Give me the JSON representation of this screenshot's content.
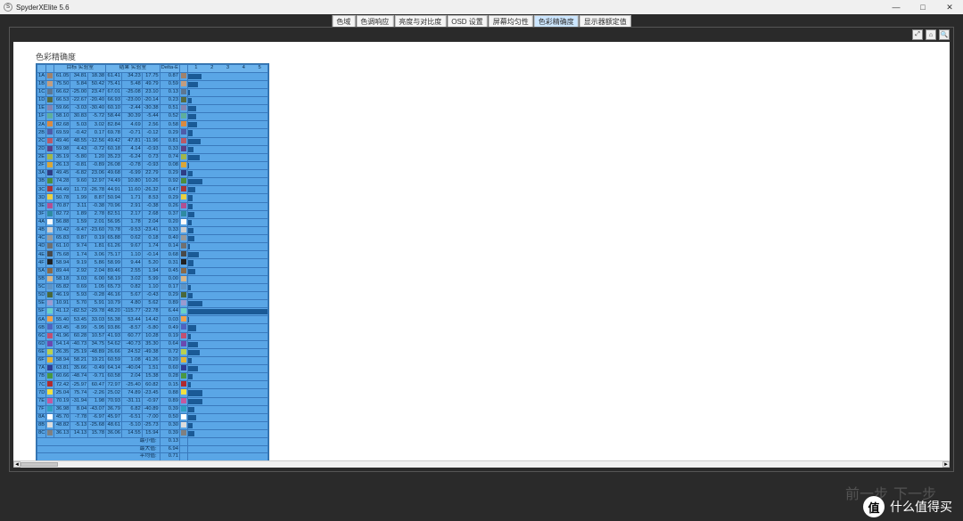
{
  "app": {
    "icon": "S",
    "title": "SpyderXElite 5.6"
  },
  "winbtn": {
    "min": "—",
    "max": "□",
    "close": "✕"
  },
  "tabs": [
    "色域",
    "色调响应",
    "亮度与对比度",
    "OSD 设置",
    "屏幕均匀性",
    "色彩精确度",
    "显示器额定值"
  ],
  "active_tab": 5,
  "toolbar": {
    "i1": "⤢",
    "i2": "⌂",
    "i3": "🔍"
  },
  "scroll": {
    "left": "◄",
    "right": "►"
  },
  "report": {
    "title": "色彩精确度"
  },
  "header": {
    "idx": "",
    "swatch": "",
    "target": "目标 实验室",
    "result": "结果 实验室",
    "delta": "Delta-E",
    "axis": [
      "1",
      "2",
      "3",
      "4",
      "5"
    ]
  },
  "summary": {
    "min_label": "最小值:",
    "min": "0.13",
    "max_label": "最大值:",
    "max": "6.94",
    "avg_label": "平均值:",
    "avg": "0.71"
  },
  "footer": {
    "prev": "前一步",
    "next": "下一步"
  },
  "watermark": {
    "logo": "值",
    "text": "什么值得买"
  },
  "chart_data": {
    "type": "table+bar",
    "bar_axis_max": 5,
    "columns": [
      "idx",
      "color",
      "target_L",
      "target_a",
      "target_b",
      "result_L",
      "result_a",
      "result_b",
      "delta_e"
    ],
    "rows": [
      {
        "idx": "1A",
        "color": "#a0826b",
        "t": [
          61.05,
          34.81,
          18.38
        ],
        "r": [
          61.41,
          34.23,
          17.75
        ],
        "d": 0.87
      },
      {
        "idx": "1B",
        "color": "#c29d80",
        "t": [
          75.5,
          5.84,
          50.42
        ],
        "r": [
          75.41,
          5.48,
          49.79
        ],
        "d": 0.59
      },
      {
        "idx": "1C",
        "color": "#5e7792",
        "t": [
          66.62,
          -25.0,
          23.47
        ],
        "r": [
          67.01,
          -25.08,
          23.1
        ],
        "d": 0.13
      },
      {
        "idx": "1D",
        "color": "#576b42",
        "t": [
          66.53,
          -22.67,
          -20.4
        ],
        "r": [
          66.93,
          -23.0,
          -20.14
        ],
        "d": 0.23
      },
      {
        "idx": "1E",
        "color": "#8585b0",
        "t": [
          59.66,
          -3.03,
          -30.4
        ],
        "r": [
          60.1,
          -2.44,
          -30.38
        ],
        "d": 0.51
      },
      {
        "idx": "1F",
        "color": "#5fae9b",
        "t": [
          58.1,
          30.83,
          -5.72
        ],
        "r": [
          58.44,
          30.39,
          -5.44
        ],
        "d": 0.52
      },
      {
        "idx": "2A",
        "color": "#d98a40",
        "t": [
          82.68,
          5.03,
          3.02
        ],
        "r": [
          82.84,
          4.69,
          2.56
        ],
        "d": 0.58
      },
      {
        "idx": "2B",
        "color": "#4f5da9",
        "t": [
          69.59,
          -0.42,
          0.17
        ],
        "r": [
          69.78,
          -0.71,
          -0.12
        ],
        "d": 0.29
      },
      {
        "idx": "2C",
        "color": "#ba5a68",
        "t": [
          49.46,
          48.55,
          -12.56
        ],
        "r": [
          49.42,
          47.81,
          -11.96
        ],
        "d": 0.81
      },
      {
        "idx": "2D",
        "color": "#5c4086",
        "t": [
          59.98,
          4.43,
          -0.72
        ],
        "r": [
          60.18,
          4.14,
          -0.93
        ],
        "d": 0.33
      },
      {
        "idx": "2E",
        "color": "#a1b649",
        "t": [
          35.19,
          -5.8,
          1.2
        ],
        "r": [
          35.23,
          -6.24,
          0.73
        ],
        "d": 0.74
      },
      {
        "idx": "2F",
        "color": "#d9a638",
        "t": [
          26.13,
          -0.81,
          -0.89
        ],
        "r": [
          26.08,
          -0.78,
          -0.93
        ],
        "d": 0.08
      },
      {
        "idx": "3A",
        "color": "#2f3d85",
        "t": [
          49.45,
          -6.82,
          23.06
        ],
        "r": [
          49.68,
          -6.99,
          22.79
        ],
        "d": 0.29
      },
      {
        "idx": "3B",
        "color": "#4d8d3f",
        "t": [
          74.28,
          9.6,
          12.97
        ],
        "r": [
          74.49,
          10.8,
          10.26
        ],
        "d": 0.92
      },
      {
        "idx": "3C",
        "color": "#a93539",
        "t": [
          44.49,
          11.73,
          -26.78
        ],
        "r": [
          44.91,
          11.6,
          -26.32
        ],
        "d": 0.47
      },
      {
        "idx": "3D",
        "color": "#ead041",
        "t": [
          50.78,
          1.99,
          8.87
        ],
        "r": [
          50.94,
          1.71,
          8.53
        ],
        "d": 0.29
      },
      {
        "idx": "3E",
        "color": "#b25091",
        "t": [
          70.87,
          3.11,
          -0.38
        ],
        "r": [
          70.96,
          2.91,
          -0.38
        ],
        "d": 0.26
      },
      {
        "idx": "3F",
        "color": "#2f8ba2",
        "t": [
          82.72,
          1.89,
          2.78
        ],
        "r": [
          82.51,
          2.17,
          2.68
        ],
        "d": 0.37
      },
      {
        "idx": "4A",
        "color": "#fafafa",
        "t": [
          56.88,
          1.59,
          2.01
        ],
        "r": [
          56.95,
          1.78,
          2.04
        ],
        "d": 0.2
      },
      {
        "idx": "4B",
        "color": "#cccccc",
        "t": [
          70.42,
          -9.47,
          -23.6
        ],
        "r": [
          70.78,
          -9.53,
          -23.41
        ],
        "d": 0.33
      },
      {
        "idx": "4C",
        "color": "#999999",
        "t": [
          65.83,
          0.87,
          0.19
        ],
        "r": [
          65.88,
          0.62,
          0.18
        ],
        "d": 0.4
      },
      {
        "idx": "4D",
        "color": "#707070",
        "t": [
          61.1,
          9.74,
          1.81
        ],
        "r": [
          61.26,
          9.67,
          1.74
        ],
        "d": 0.14
      },
      {
        "idx": "4E",
        "color": "#4a4a4a",
        "t": [
          75.68,
          1.74,
          3.06
        ],
        "r": [
          75.17,
          1.1,
          -0.14
        ],
        "d": 0.68
      },
      {
        "idx": "4F",
        "color": "#222222",
        "t": [
          58.94,
          9.19,
          5.86
        ],
        "r": [
          58.99,
          9.44,
          5.2
        ],
        "d": 0.31
      },
      {
        "idx": "5A",
        "color": "#8a6a4a",
        "t": [
          89.44,
          2.92,
          2.04
        ],
        "r": [
          89.46,
          2.55,
          1.94
        ],
        "d": 0.45
      },
      {
        "idx": "5B",
        "color": "#d8b588",
        "t": [
          58.18,
          3.03,
          6.0
        ],
        "r": [
          58.19,
          3.02,
          5.99
        ],
        "d": 0.0
      },
      {
        "idx": "5C",
        "color": "#5e94c6",
        "t": [
          65.82,
          0.69,
          1.05
        ],
        "r": [
          65.73,
          0.82,
          1.1
        ],
        "d": 0.17
      },
      {
        "idx": "5D",
        "color": "#4a683a",
        "t": [
          46.19,
          5.93,
          -0.28
        ],
        "r": [
          46.16,
          5.67,
          -0.43
        ],
        "d": 0.29
      },
      {
        "idx": "5E",
        "color": "#9a9bd0",
        "t": [
          10.91,
          5.7,
          5.91
        ],
        "r": [
          10.79,
          4.8,
          5.62
        ],
        "d": 0.89
      },
      {
        "idx": "5F",
        "color": "#6bd0c5",
        "t": [
          41.12,
          -82.52,
          -29.78
        ],
        "r": [
          48.2,
          -115.77,
          -22.78
        ],
        "d": 6.44
      },
      {
        "idx": "6A",
        "color": "#f0a14a",
        "t": [
          55.4,
          53.45,
          33.03
        ],
        "r": [
          55.38,
          53.44,
          14.42
        ],
        "d": 0.03
      },
      {
        "idx": "6B",
        "color": "#4f64c0",
        "t": [
          93.45,
          -8.99,
          -5.95
        ],
        "r": [
          93.86,
          -8.57,
          -5.8
        ],
        "d": 0.49
      },
      {
        "idx": "6C",
        "color": "#c15070",
        "t": [
          41.96,
          60.28,
          10.57
        ],
        "r": [
          41.93,
          60.77,
          10.28
        ],
        "d": 0.19
      },
      {
        "idx": "6D",
        "color": "#6b4ab0",
        "t": [
          54.14,
          -40.73,
          34.75
        ],
        "r": [
          54.62,
          -40.73,
          35.3
        ],
        "d": 0.64
      },
      {
        "idx": "6E",
        "color": "#bad050",
        "t": [
          26.35,
          25.19,
          -48.89
        ],
        "r": [
          26.66,
          24.52,
          -49.38
        ],
        "d": 0.72
      },
      {
        "idx": "6F",
        "color": "#e0b43a",
        "t": [
          58.94,
          58.21,
          19.21
        ],
        "r": [
          60.59,
          1.08,
          41.26
        ],
        "d": 0.2
      },
      {
        "idx": "7A",
        "color": "#2f3d95",
        "t": [
          63.81,
          35.66,
          -0.49
        ],
        "r": [
          64.14,
          -40.04,
          1.51
        ],
        "d": 0.6
      },
      {
        "idx": "7B",
        "color": "#4a9840",
        "t": [
          60.66,
          -48.74,
          -9.71
        ],
        "r": [
          60.58,
          2.04,
          15.38
        ],
        "d": 0.28
      },
      {
        "idx": "7C",
        "color": "#b02a2e",
        "t": [
          72.42,
          -25.97,
          60.47
        ],
        "r": [
          72.97,
          -25.4,
          60.82
        ],
        "d": 0.15
      },
      {
        "idx": "7D",
        "color": "#f2e041",
        "t": [
          25.04,
          75.74,
          -2.26
        ],
        "r": [
          25.02,
          74.89,
          -23.45
        ],
        "d": 0.88
      },
      {
        "idx": "7E",
        "color": "#c35aa0",
        "t": [
          70.19,
          -31.94,
          1.98
        ],
        "r": [
          70.93,
          -31.11,
          -0.97
        ],
        "d": 0.89
      },
      {
        "idx": "7F",
        "color": "#30a0c0",
        "t": [
          36.98,
          8.04,
          -43.07
        ],
        "r": [
          36.79,
          6.82,
          -40.89
        ],
        "d": 0.39
      },
      {
        "idx": "8A",
        "color": "#fefefe",
        "t": [
          45.7,
          -7.78,
          -6.97
        ],
        "r": [
          45.97,
          -6.51,
          -7.0
        ],
        "d": 0.5
      },
      {
        "idx": "8B",
        "color": "#dcdcdc",
        "t": [
          48.82,
          -5.13,
          -25.68
        ],
        "r": [
          48.61,
          -5.1,
          -25.73
        ],
        "d": 0.3
      },
      {
        "idx": "8C",
        "color": "#808080",
        "t": [
          36.13,
          14.13,
          15.78
        ],
        "r": [
          36.06,
          14.55,
          15.94
        ],
        "d": 0.39
      }
    ]
  }
}
